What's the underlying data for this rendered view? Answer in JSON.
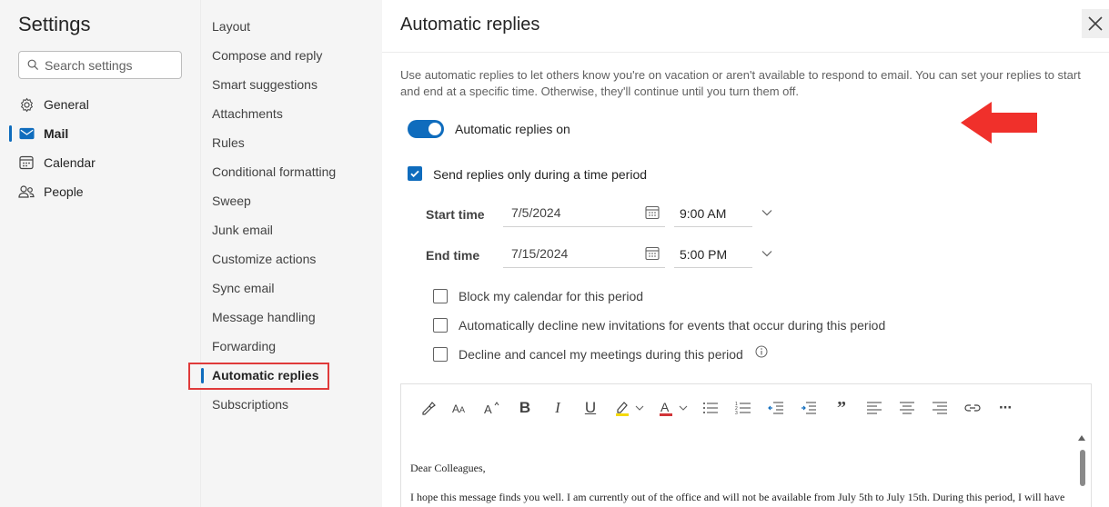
{
  "nav": {
    "title": "Settings",
    "search_placeholder": "Search settings",
    "items": [
      {
        "label": "General",
        "icon": "gear-icon"
      },
      {
        "label": "Mail",
        "icon": "mail-icon"
      },
      {
        "label": "Calendar",
        "icon": "calendar-icon"
      },
      {
        "label": "People",
        "icon": "people-icon"
      }
    ],
    "active": "Mail"
  },
  "subnav": {
    "items": [
      "Layout",
      "Compose and reply",
      "Smart suggestions",
      "Attachments",
      "Rules",
      "Conditional formatting",
      "Sweep",
      "Junk email",
      "Customize actions",
      "Sync email",
      "Message handling",
      "Forwarding",
      "Automatic replies",
      "Subscriptions"
    ],
    "active": "Automatic replies"
  },
  "main": {
    "title": "Automatic replies",
    "description": "Use automatic replies to let others know you're on vacation or aren't available to respond to email. You can set your replies to start and end at a specific time. Otherwise, they'll continue until you turn them off.",
    "toggle_label": "Automatic replies on",
    "toggle_on": true,
    "send_period_label": "Send replies only during a time period",
    "send_period_checked": true,
    "start_label": "Start time",
    "start_date": "7/5/2024",
    "start_time": "9:00 AM",
    "end_label": "End time",
    "end_date": "7/15/2024",
    "end_time": "5:00 PM",
    "options": [
      {
        "label": "Block my calendar for this period",
        "checked": false
      },
      {
        "label": "Automatically decline new invitations for events that occur during this period",
        "checked": false
      },
      {
        "label": "Decline and cancel my meetings during this period",
        "checked": false
      }
    ]
  },
  "editor": {
    "toolbar": [
      "format-painter-icon",
      "font-size-icon",
      "grow-font-icon",
      "bold-icon",
      "italic-icon",
      "underline-icon",
      "highlight-icon",
      "font-color-icon",
      "bullets-icon",
      "numbering-icon",
      "decrease-indent-icon",
      "increase-indent-icon",
      "quote-icon",
      "align-left-icon",
      "align-center-icon",
      "align-right-icon",
      "link-icon",
      "more-icon"
    ],
    "bold_glyph": "B",
    "italic_glyph": "I",
    "underline_glyph": "U",
    "quote_glyph": "”",
    "more_glyph": "···",
    "body_line1": "Dear Colleagues,",
    "body_line2": "I hope this message finds you well. I am currently out of the office and will not be available from July 5th to July 15th. During this period, I will have"
  },
  "colors": {
    "accent": "#0f6cbd",
    "highlight_box": "#e03a3a",
    "arrow": "#f0302b"
  }
}
